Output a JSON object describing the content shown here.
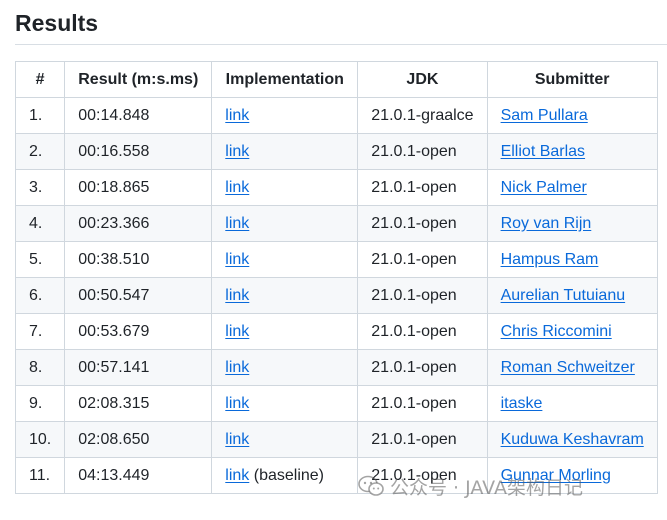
{
  "heading": "Results",
  "table": {
    "headers": {
      "num": "#",
      "result": "Result (m:s.ms)",
      "implementation": "Implementation",
      "jdk": "JDK",
      "submitter": "Submitter"
    },
    "rows": [
      {
        "num": "1.",
        "result": "00:14.848",
        "implementation": "link",
        "impl_note": "",
        "jdk": "21.0.1-graalce",
        "submitter": "Sam Pullara"
      },
      {
        "num": "2.",
        "result": "00:16.558",
        "implementation": "link",
        "impl_note": "",
        "jdk": "21.0.1-open",
        "submitter": "Elliot Barlas"
      },
      {
        "num": "3.",
        "result": "00:18.865",
        "implementation": "link",
        "impl_note": "",
        "jdk": "21.0.1-open",
        "submitter": "Nick Palmer"
      },
      {
        "num": "4.",
        "result": "00:23.366",
        "implementation": "link",
        "impl_note": "",
        "jdk": "21.0.1-open",
        "submitter": "Roy van Rijn"
      },
      {
        "num": "5.",
        "result": "00:38.510",
        "implementation": "link",
        "impl_note": "",
        "jdk": "21.0.1-open",
        "submitter": "Hampus Ram"
      },
      {
        "num": "6.",
        "result": "00:50.547",
        "implementation": "link",
        "impl_note": "",
        "jdk": "21.0.1-open",
        "submitter": "Aurelian Tutuianu"
      },
      {
        "num": "7.",
        "result": "00:53.679",
        "implementation": "link",
        "impl_note": "",
        "jdk": "21.0.1-open",
        "submitter": "Chris Riccomini"
      },
      {
        "num": "8.",
        "result": "00:57.141",
        "implementation": "link",
        "impl_note": "",
        "jdk": "21.0.1-open",
        "submitter": "Roman Schweitzer"
      },
      {
        "num": "9.",
        "result": "02:08.315",
        "implementation": "link",
        "impl_note": "",
        "jdk": "21.0.1-open",
        "submitter": "itaske"
      },
      {
        "num": "10.",
        "result": "02:08.650",
        "implementation": "link",
        "impl_note": "",
        "jdk": "21.0.1-open",
        "submitter": "Kuduwa Keshavram"
      },
      {
        "num": "11.",
        "result": "04:13.449",
        "implementation": "link",
        "impl_note": "(baseline)",
        "jdk": "21.0.1-open",
        "submitter": "Gunnar Morling"
      }
    ]
  },
  "watermark": {
    "text": "公众号 · JAVA架构日记",
    "icon": "wechat-logo-icon"
  },
  "colors": {
    "link": "#0969da",
    "border": "#d0d7de",
    "stripe": "#f6f8fa",
    "text": "#1f2328"
  }
}
